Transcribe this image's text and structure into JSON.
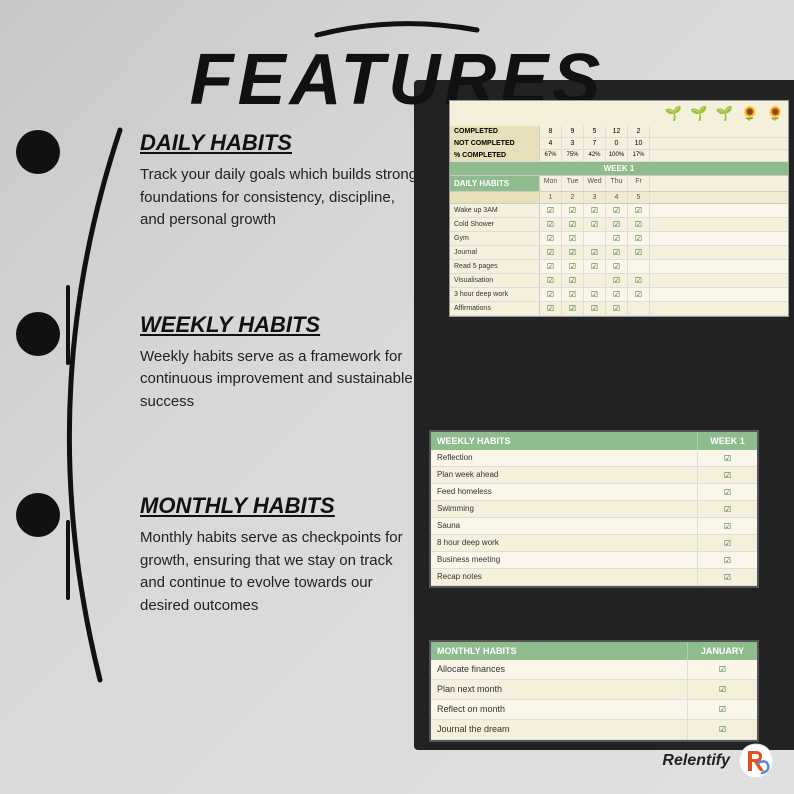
{
  "page": {
    "title": "FEATURES",
    "brush_stroke": "decorative brush stroke"
  },
  "sections": [
    {
      "id": "daily",
      "title": "DAILY HABITS",
      "description": "Track your daily goals which builds strong foundations for consistency, discipline, and personal growth"
    },
    {
      "id": "weekly",
      "title": "WEEKLY HABITS",
      "description": "Weekly habits serve as a framework for continuous improvement and sustainable success"
    },
    {
      "id": "monthly",
      "title": "MONTHLY HABITS",
      "description": "Monthly habits serve as checkpoints for growth, ensuring that we stay on track and continue to evolve towards our desired outcomes"
    }
  ],
  "daily_table": {
    "stats": [
      {
        "label": "COMPLETED",
        "values": [
          "8",
          "9",
          "5",
          "12",
          "2"
        ]
      },
      {
        "label": "NOT COMPLETED",
        "values": [
          "4",
          "3",
          "7",
          "0",
          "10"
        ]
      },
      {
        "label": "% COMPLETED",
        "values": [
          "67%",
          "75%",
          "42%",
          "100%",
          "17%"
        ]
      }
    ],
    "week_label": "WEEK 1",
    "days": [
      "Mon",
      "Tue",
      "Wed",
      "Thu",
      "Fr"
    ],
    "day_nums": [
      "1",
      "2",
      "3",
      "4",
      "5"
    ],
    "habits": [
      "Wake up 3AM",
      "Cold Shower",
      "Gym",
      "Journal",
      "Read 5 pages",
      "Visualisation",
      "3 hour deep work",
      "Affirmations"
    ]
  },
  "weekly_table": {
    "header_label": "WEEKLY HABITS",
    "header_week": "WEEK 1",
    "habits": [
      "Reflection",
      "Plan week ahead",
      "Feed homeless",
      "Swimming",
      "Sauna",
      "8 hour deep work",
      "Business meeting",
      "Recap notes"
    ]
  },
  "monthly_table": {
    "header_label": "MONTHLY HABITS",
    "header_month": "JANUARY",
    "habits": [
      "Allocate finances",
      "Plan next month",
      "Reflect on month",
      "Journal the dream"
    ]
  },
  "logo": {
    "name": "Relentify",
    "icon_label": "R"
  }
}
